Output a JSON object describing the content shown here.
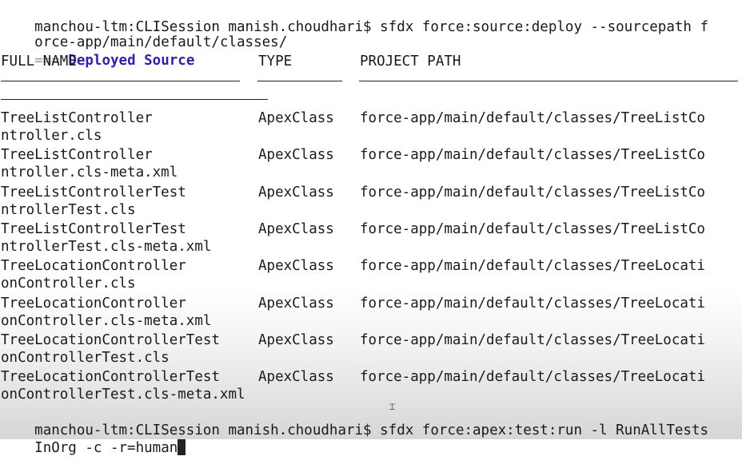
{
  "prompt1": {
    "line1": "manchou-ltm:CLISession manish.choudhari$ sfdx force:source:deploy --sourcepath f",
    "line2": "orce-app/main/default/classes/"
  },
  "section": {
    "prefix": "===",
    "title": "Deployed Source"
  },
  "table": {
    "headers": {
      "name": "FULL NAME",
      "type": "TYPE",
      "path": "PROJECT PATH"
    },
    "rows": [
      {
        "name": "TreeListController",
        "type": "ApexClass",
        "path": "force-app/main/default/classes/TreeListCo",
        "wrap": "ntroller.cls"
      },
      {
        "name": "TreeListController",
        "type": "ApexClass",
        "path": "force-app/main/default/classes/TreeListCo",
        "wrap": "ntroller.cls-meta.xml"
      },
      {
        "name": "TreeListControllerTest",
        "type": "ApexClass",
        "path": "force-app/main/default/classes/TreeListCo",
        "wrap": "ntrollerTest.cls"
      },
      {
        "name": "TreeListControllerTest",
        "type": "ApexClass",
        "path": "force-app/main/default/classes/TreeListCo",
        "wrap": "ntrollerTest.cls-meta.xml"
      },
      {
        "name": "TreeLocationController",
        "type": "ApexClass",
        "path": "force-app/main/default/classes/TreeLocati",
        "wrap": "onController.cls"
      },
      {
        "name": "TreeLocationController",
        "type": "ApexClass",
        "path": "force-app/main/default/classes/TreeLocati",
        "wrap": "onController.cls-meta.xml"
      },
      {
        "name": "TreeLocationControllerTest",
        "type": "ApexClass",
        "path": "force-app/main/default/classes/TreeLocati",
        "wrap": "onControllerTest.cls"
      },
      {
        "name": "TreeLocationControllerTest",
        "type": "ApexClass",
        "path": "force-app/main/default/classes/TreeLocati",
        "wrap": "onControllerTest.cls-meta.xml"
      }
    ]
  },
  "prompt2": {
    "line1": "manchou-ltm:CLISession manish.choudhari$ sfdx force:apex:test:run -l RunAllTests",
    "line2": "InOrg -c -r=human"
  },
  "colors": {
    "text": "#1a1a1a",
    "section_title": "#2c1fb6",
    "section_prefix": "#9a9a9a",
    "background": "#ffffff"
  }
}
